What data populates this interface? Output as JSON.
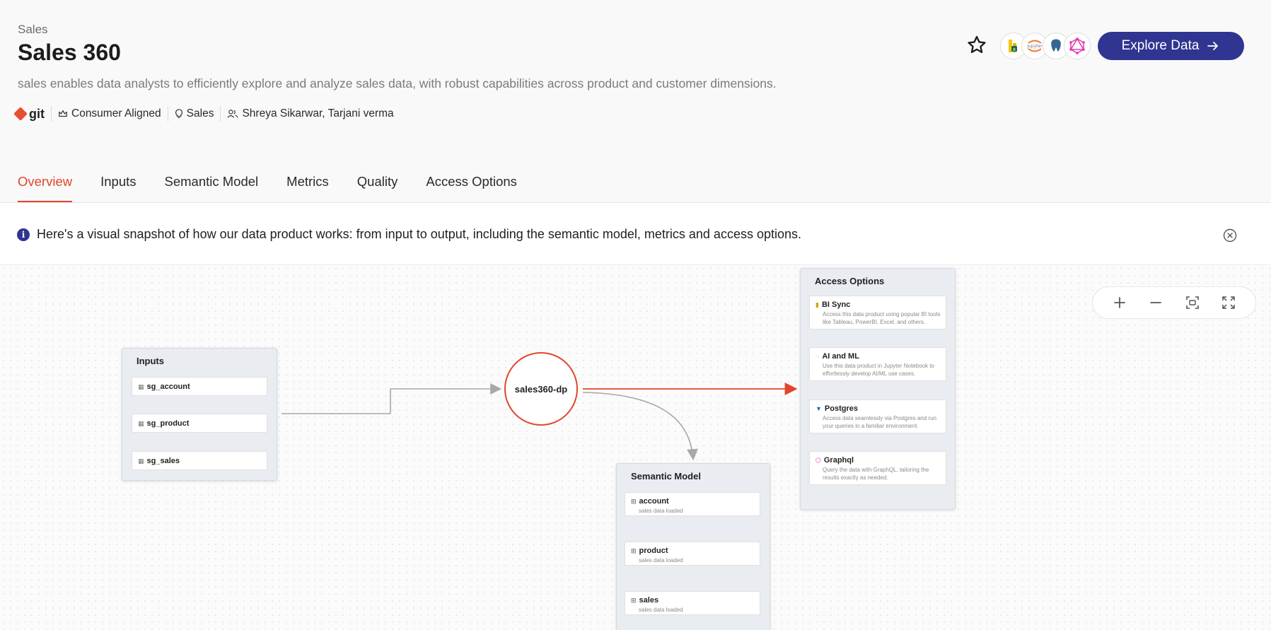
{
  "header": {
    "breadcrumb": "Sales",
    "title": "Sales 360",
    "description": "sales enables data analysts to efficiently explore and analyze sales data, with robust capabilities across product and customer dimensions.",
    "git_label": "git",
    "alignment": "Consumer Aligned",
    "domain": "Sales",
    "owners": "Shreya Sikarwar, Tarjani verma",
    "explore_label": "Explore Data",
    "avatars": [
      "excel-icon",
      "jupyter-icon",
      "postgres-icon",
      "graphql-icon"
    ]
  },
  "tabs": [
    {
      "label": "Overview",
      "active": true
    },
    {
      "label": "Inputs"
    },
    {
      "label": "Semantic Model"
    },
    {
      "label": "Metrics"
    },
    {
      "label": "Quality"
    },
    {
      "label": "Access Options"
    }
  ],
  "banner": {
    "text": "Here's a visual snapshot of how our data product works: from input to output, including the semantic model, metrics and access options."
  },
  "graph": {
    "inputs": {
      "title": "Inputs",
      "items": [
        "sg_account",
        "sg_product",
        "sg_sales"
      ]
    },
    "data_product": "sales360-dp",
    "semantic_model": {
      "title": "Semantic Model",
      "items": [
        {
          "name": "account",
          "sub": "sales data loaded"
        },
        {
          "name": "product",
          "sub": "sales data loaded"
        },
        {
          "name": "sales",
          "sub": "sales data loaded"
        }
      ]
    },
    "access_options": {
      "title": "Access Options",
      "items": [
        {
          "name": "BI Sync",
          "sub": "Access this data product using popular BI tools like Tableau, PowerBI, Excel, and others."
        },
        {
          "name": "AI and ML",
          "sub": "Use this data product in Jupyter Notebook to effortlessly develop AI/ML use cases."
        },
        {
          "name": "Postgres",
          "sub": "Access data seamlessly via Postgres and run your queries in a familiar environment."
        },
        {
          "name": "Graphql",
          "sub": "Query the data with GraphQL, tailoring the results exactly as needed."
        }
      ]
    }
  },
  "colors": {
    "accent": "#e1452a",
    "primary": "#2f3590"
  }
}
